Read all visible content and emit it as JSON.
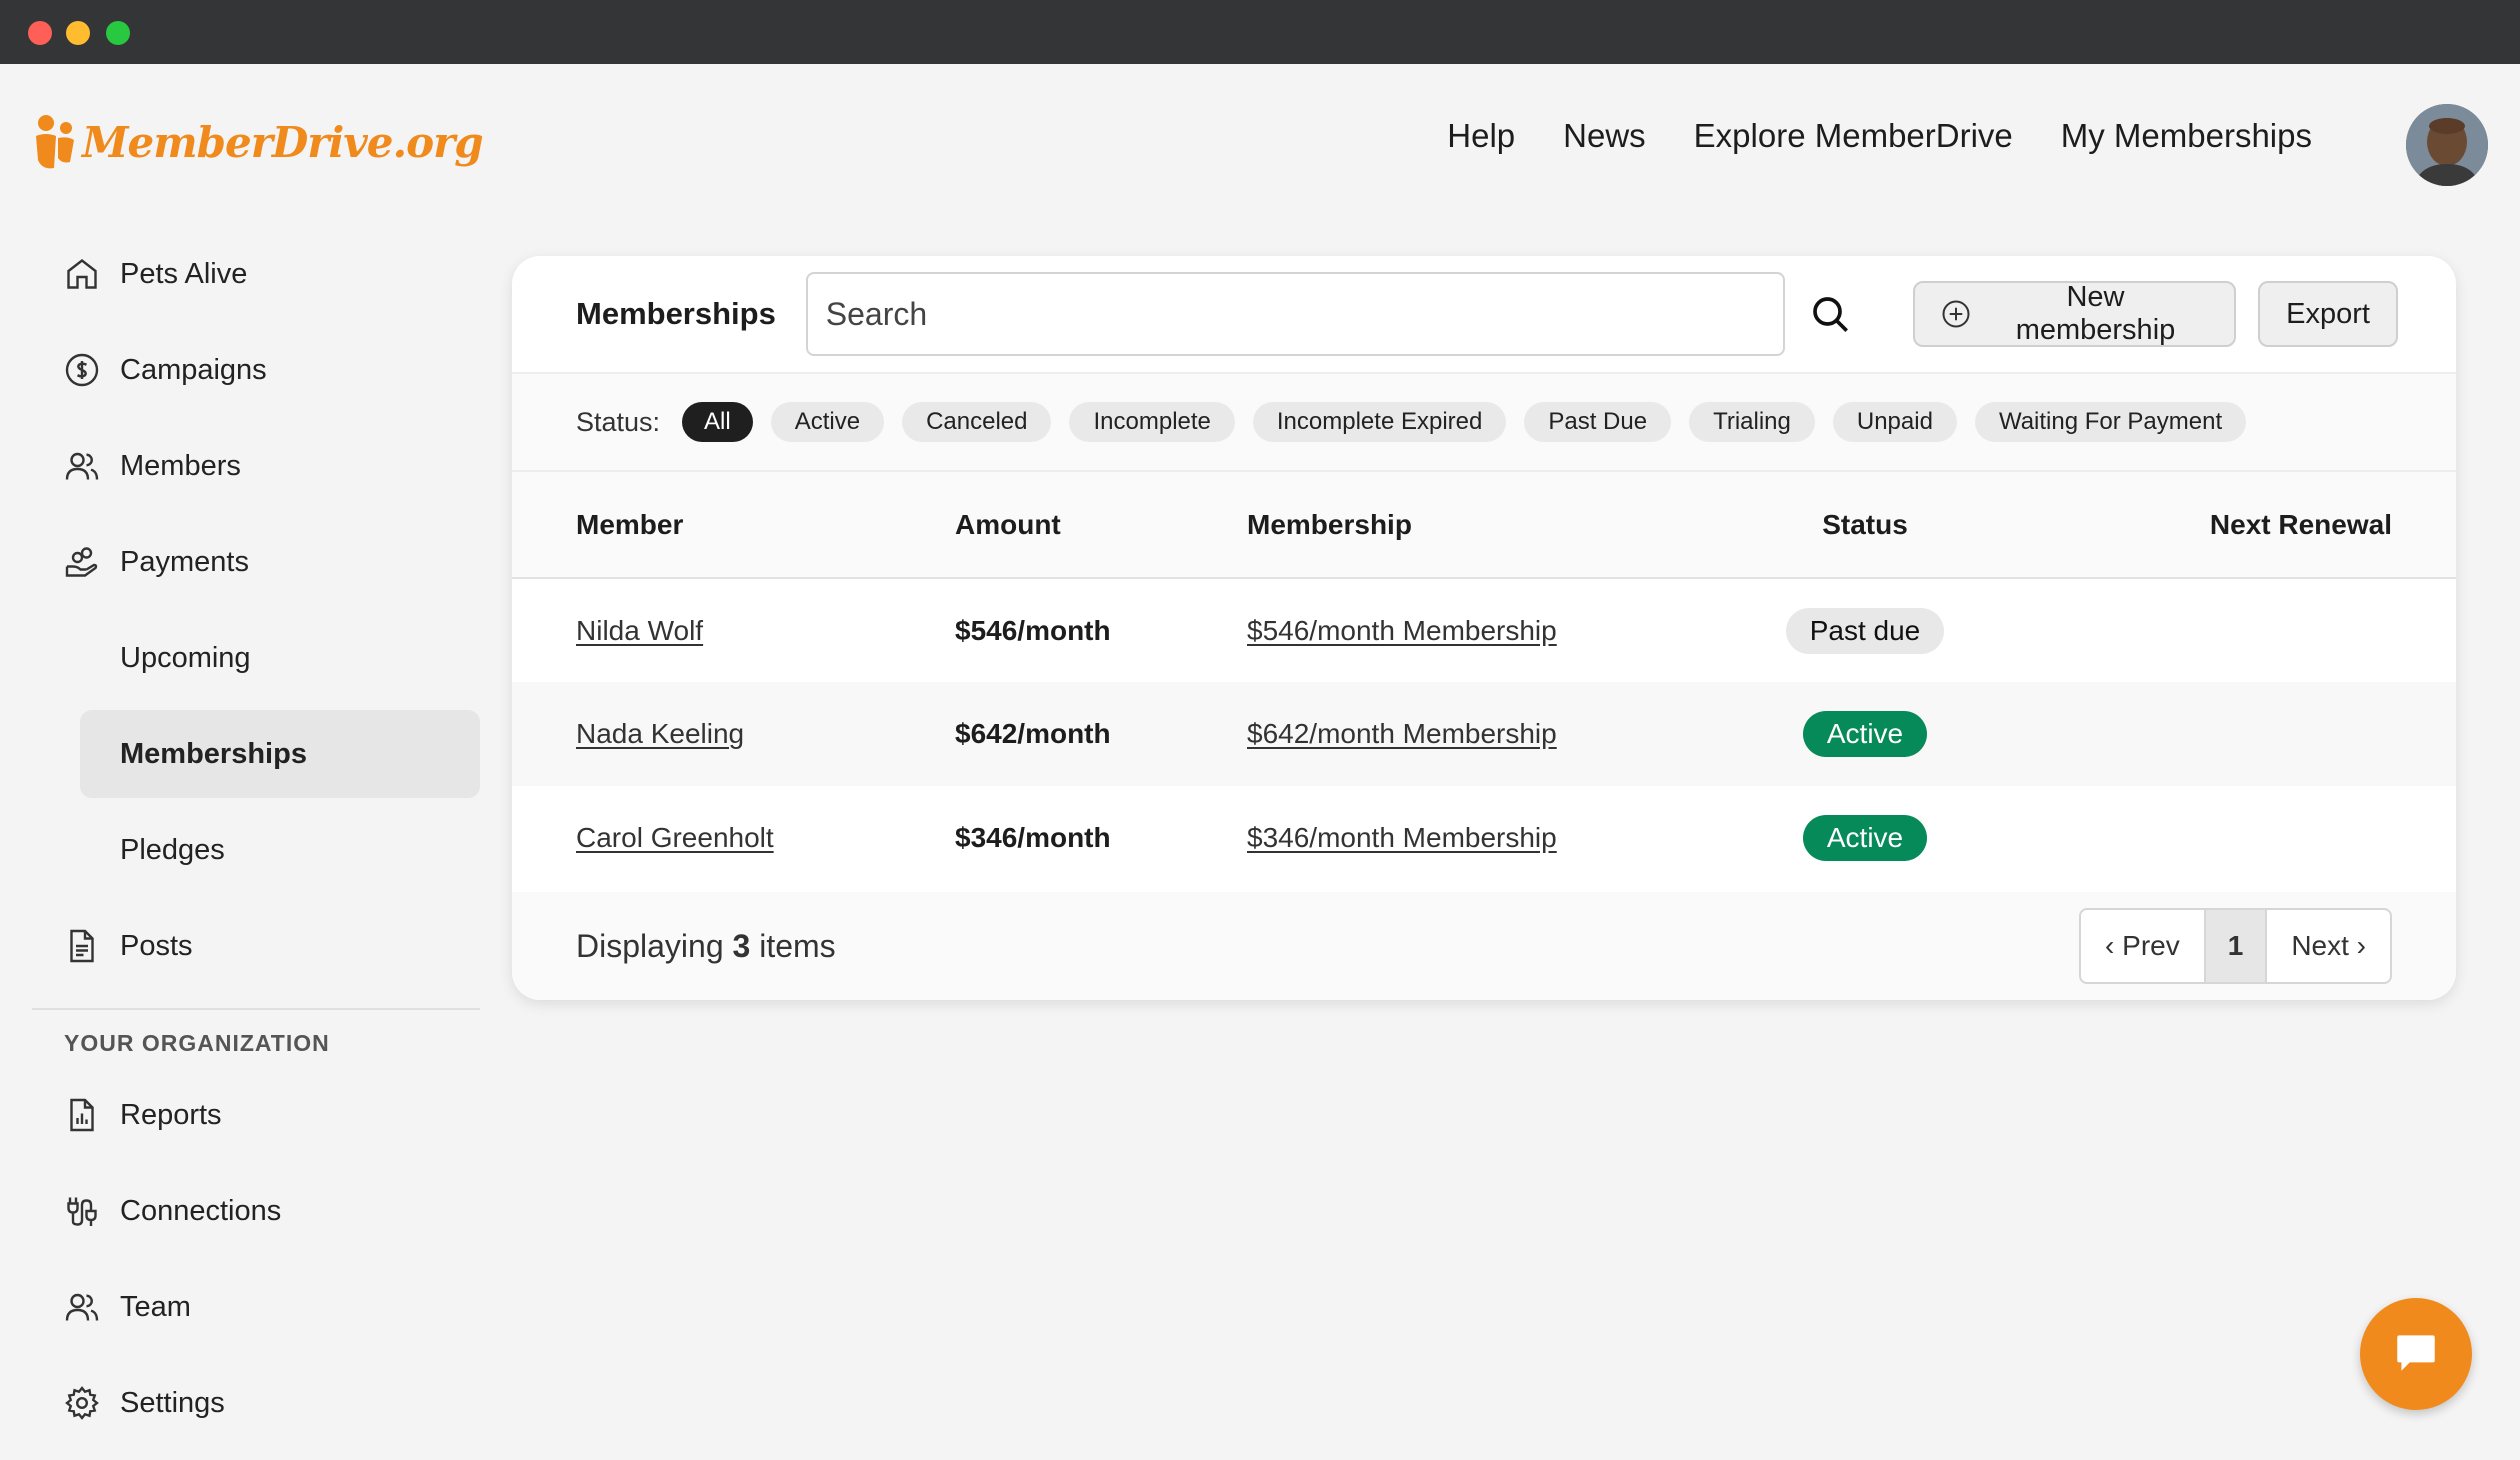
{
  "brand": {
    "logo_text": "MemberDrive.org",
    "accent": "#f08a1c"
  },
  "topnav": {
    "items": [
      "Help",
      "News",
      "Explore MemberDrive",
      "My Memberships"
    ]
  },
  "sidebar": {
    "items": [
      {
        "label": "Pets Alive",
        "icon": "home-icon"
      },
      {
        "label": "Campaigns",
        "icon": "dollar-circle-icon"
      },
      {
        "label": "Members",
        "icon": "users-icon"
      },
      {
        "label": "Payments",
        "icon": "hand-coins-icon"
      },
      {
        "label": "Upcoming"
      },
      {
        "label": "Memberships"
      },
      {
        "label": "Pledges"
      },
      {
        "label": "Posts",
        "icon": "document-icon"
      }
    ],
    "org_heading": "YOUR ORGANIZATION",
    "org_items": [
      {
        "label": "Reports",
        "icon": "report-icon"
      },
      {
        "label": "Connections",
        "icon": "plug-icon"
      },
      {
        "label": "Team",
        "icon": "users-icon"
      },
      {
        "label": "Settings",
        "icon": "gear-icon"
      }
    ]
  },
  "card": {
    "title": "Memberships",
    "search_placeholder": "Search",
    "new_label": "New membership",
    "export_label": "Export",
    "status_label": "Status:",
    "filters": [
      "All",
      "Active",
      "Canceled",
      "Incomplete",
      "Incomplete Expired",
      "Past Due",
      "Trialing",
      "Unpaid",
      "Waiting For Payment"
    ],
    "columns": [
      "Member",
      "Amount",
      "Membership",
      "Status",
      "Next Renewal"
    ],
    "rows": [
      {
        "member": "Nilda Wolf",
        "amount": "$546/month",
        "membership": "$546/month Membership",
        "status": "Past due",
        "renewal": ""
      },
      {
        "member": "Nada Keeling",
        "amount": "$642/month",
        "membership": "$642/month Membership",
        "status": "Active",
        "renewal": ""
      },
      {
        "member": "Carol Greenholt",
        "amount": "$346/month",
        "membership": "$346/month Membership",
        "status": "Active",
        "renewal": ""
      }
    ],
    "footer": {
      "prefix": "Displaying",
      "count": "3",
      "suffix": "items"
    },
    "pager": {
      "prev": "‹ Prev",
      "page": "1",
      "next": "Next ›"
    }
  }
}
